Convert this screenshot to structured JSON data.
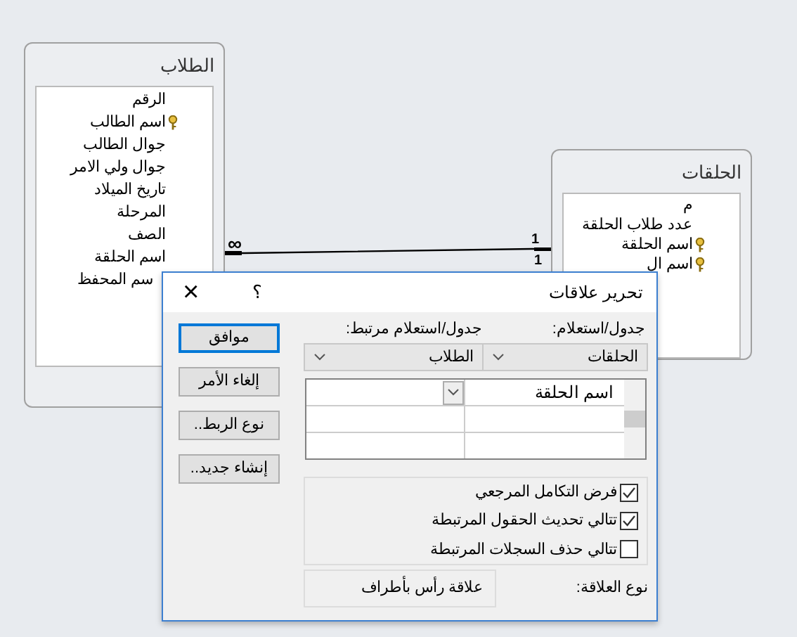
{
  "tables": [
    {
      "title": "الطلاب",
      "fields": [
        {
          "name": "الرقم",
          "key": false
        },
        {
          "name": "اسم الطالب",
          "key": true
        },
        {
          "name": "جوال الطالب",
          "key": false
        },
        {
          "name": "جوال ولي الامر",
          "key": false
        },
        {
          "name": "تاريخ الميلاد",
          "key": false
        },
        {
          "name": "المرحلة",
          "key": false
        },
        {
          "name": "الصف",
          "key": false
        },
        {
          "name": "اسم الحلقة",
          "key": false
        },
        {
          "name": "سم المحفظ"
        }
      ]
    },
    {
      "title": "الحلقات",
      "fields": [
        {
          "name": "م",
          "key": false
        },
        {
          "name": "عدد طلاب الحلقة",
          "key": false
        },
        {
          "name": "اسم الحلقة",
          "key": true
        },
        {
          "name": "اسم ال",
          "key": true
        }
      ]
    }
  ],
  "relationship": {
    "many": "∞",
    "one": "1",
    "one_second": "1"
  },
  "dialog": {
    "title": "تحرير علاقات",
    "help": "؟",
    "close": "×",
    "buttons": [
      {
        "label": "موافق",
        "default": true
      },
      {
        "label": "إلغاء الأمر",
        "default": false
      },
      {
        "label": "نوع الربط..",
        "default": false
      },
      {
        "label": "إنشاء جديد..",
        "default": false
      }
    ],
    "table_label": "جدول/استعلام:",
    "related_label": "جدول/استعلام مرتبط:",
    "table_combo": "الحلقات",
    "related_combo": "الطلاب",
    "field_rows": [
      {
        "field": "اسم الحلقة",
        "related": ""
      },
      {
        "field": "",
        "related": ""
      },
      {
        "field": "",
        "related": ""
      }
    ],
    "options": [
      {
        "label": "فرض التكامل المرجعي",
        "checked": true
      },
      {
        "label": "تتالي تحديث الحقول المرتبطة",
        "checked": true
      },
      {
        "label": "تتالي حذف السجلات المرتبطة",
        "checked": false
      }
    ],
    "relation_type_label": "نوع العلاقة:",
    "relation_type": "علاقة رأس بأطراف"
  }
}
